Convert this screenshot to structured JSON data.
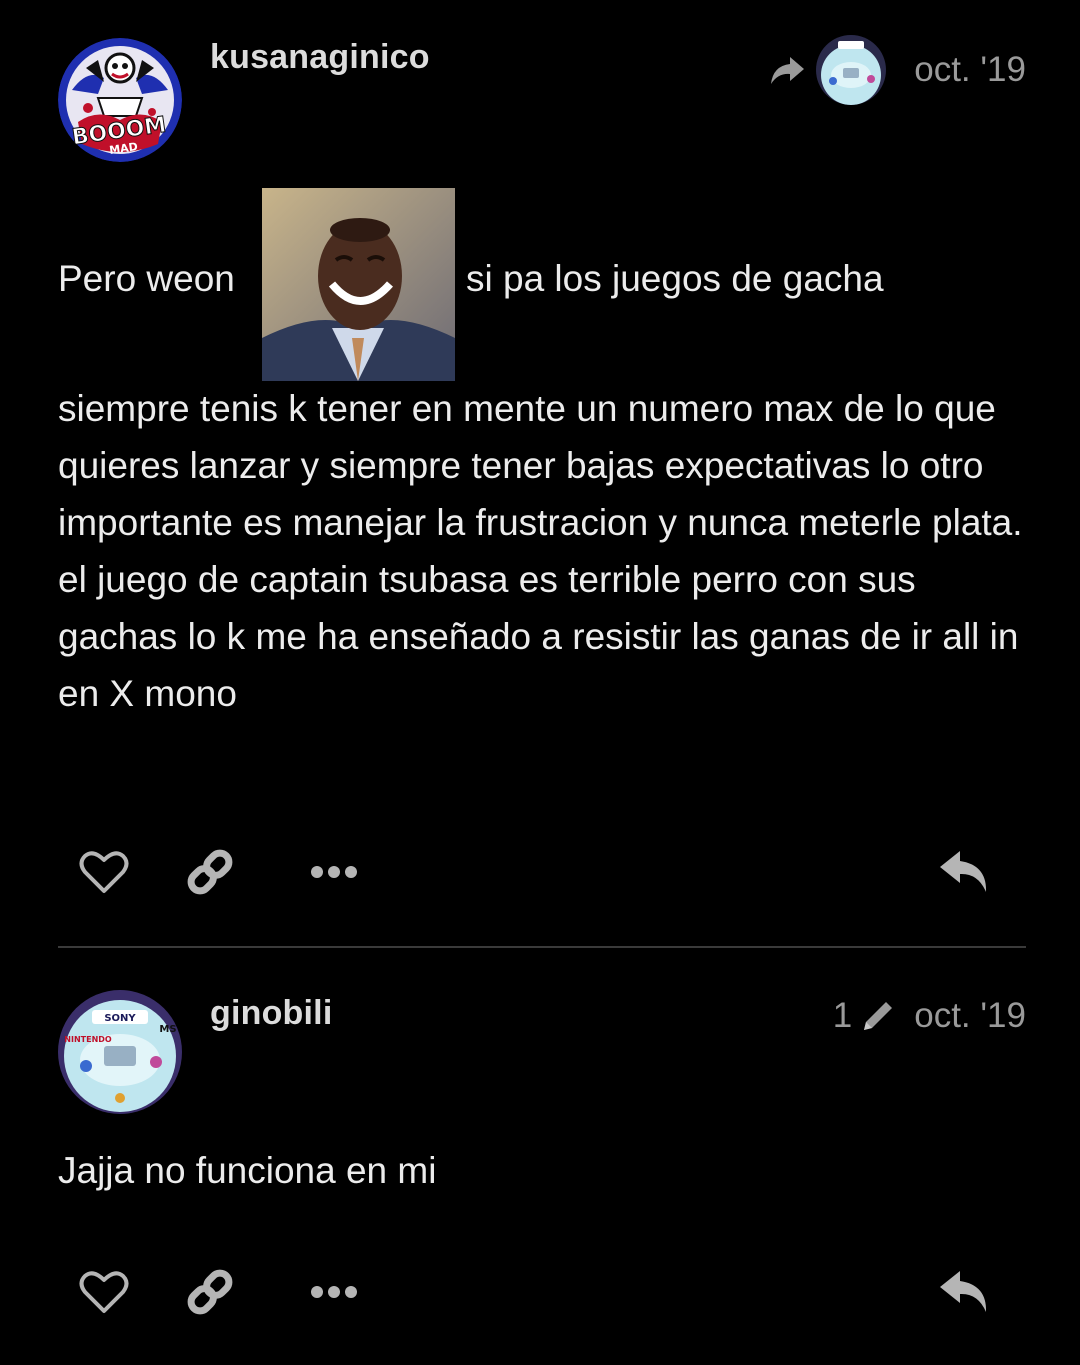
{
  "posts": [
    {
      "username": "kusanaginico",
      "date": "oct. '19",
      "reply_to_icon": "share-forward-icon",
      "text_intro": "Pero weon",
      "text_after_image": "si pa los juegos de gacha",
      "text_body": "siempre tenis k tener en mente un numero max de lo que quieres lanzar y siempre tener bajas expectativas lo otro importante es manejar la frustracion y nunca meterle plata. el juego de captain tsubasa es terrible perro con sus gachas lo k me ha enseñado a resistir las ganas de ir all in en X mono",
      "avatar_text": "BOOOM",
      "avatar_subtext": "MAD",
      "actions": [
        "heart-icon",
        "link-icon",
        "more-icon",
        "reply-icon"
      ]
    },
    {
      "username": "ginobili",
      "edit_count": "1",
      "date": "oct. '19",
      "text_body": "Jajja no funciona en mi",
      "avatar_labels": [
        "SONY",
        "NINTENDO",
        "MS"
      ],
      "actions": [
        "heart-icon",
        "link-icon",
        "more-icon",
        "reply-icon"
      ]
    }
  ]
}
